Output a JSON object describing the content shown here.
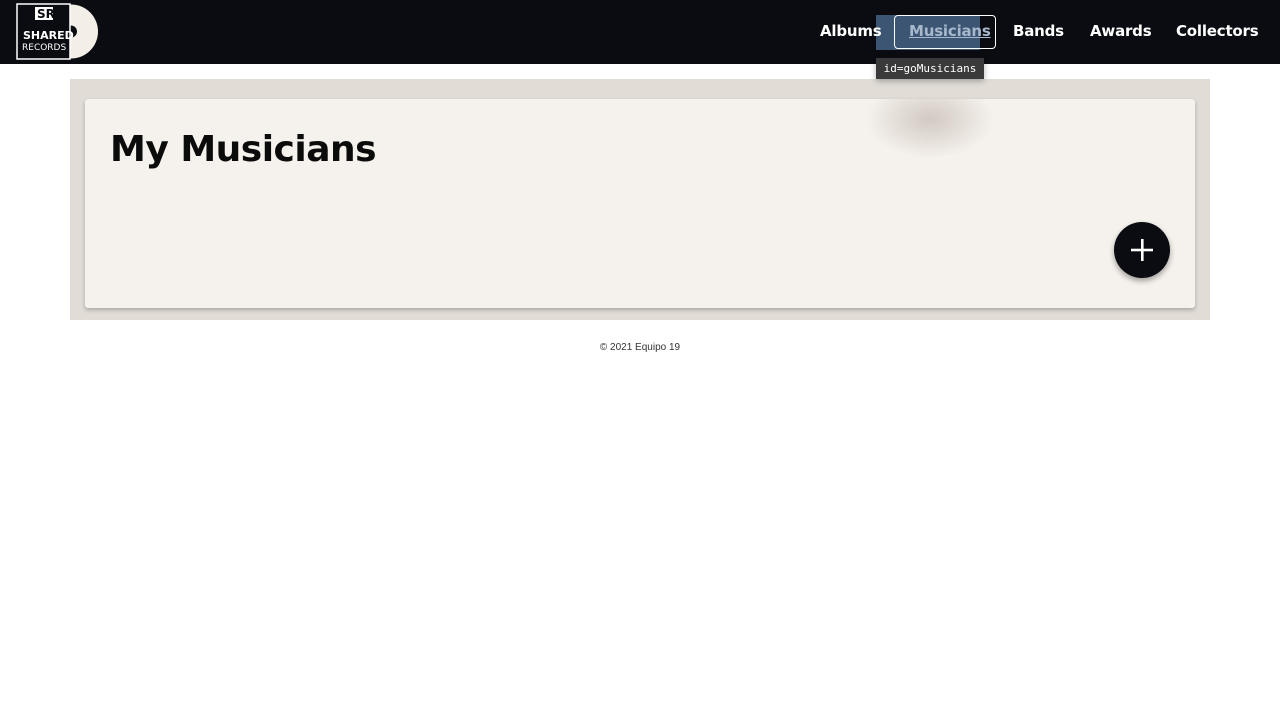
{
  "brand": {
    "logo_text_line1": "SR",
    "logo_text_line2": "SHARED",
    "logo_text_line3": "RECORDS"
  },
  "nav": {
    "items": [
      {
        "label": "Albums"
      },
      {
        "label": "Musicians"
      },
      {
        "label": "Bands"
      },
      {
        "label": "Awards"
      },
      {
        "label": "Collectors"
      }
    ],
    "active": "Musicians"
  },
  "tooltip": {
    "text": "id=goMusicians"
  },
  "main": {
    "title": "My Musicians",
    "add_icon": "plus-icon"
  },
  "footer": {
    "text": "© 2021 Equipo 19"
  },
  "colors": {
    "navbar_bg": "#0b0c11",
    "panel_bg": "#e1dcd6",
    "card_bg": "#f5f1ec",
    "highlight": "#3b5573",
    "fab_bg": "#0b0c11"
  }
}
